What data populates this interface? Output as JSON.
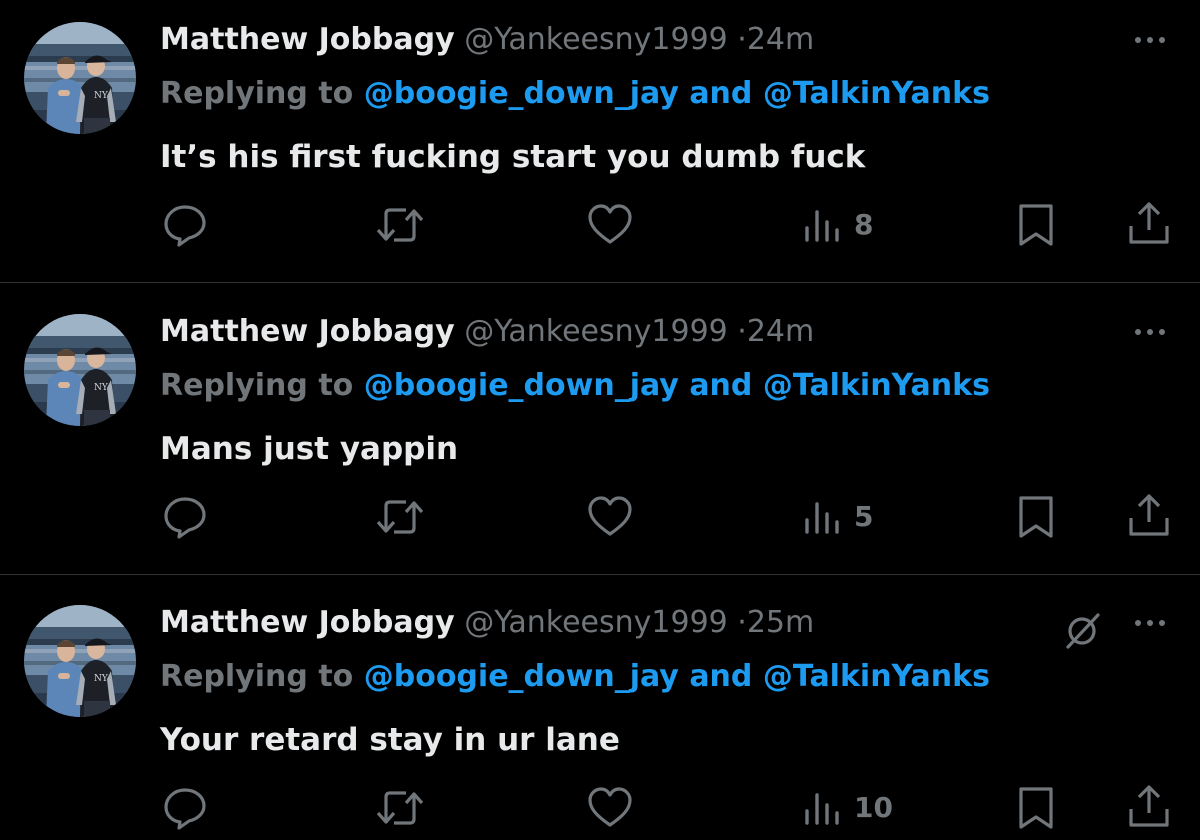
{
  "tweets": [
    {
      "display_name": "Matthew Jobbagy",
      "handle": "@Yankeesny1999",
      "separator": "·",
      "time": "24m",
      "replying_prefix": "Replying to",
      "mention_1": "@boogie_down_jay",
      "conjunction": "and",
      "mention_2": "@TalkinYanks",
      "text": "It’s his first fucking start you dumb fuck",
      "views": "8"
    },
    {
      "display_name": "Matthew Jobbagy",
      "handle": "@Yankeesny1999",
      "separator": "·",
      "time": "24m",
      "replying_prefix": "Replying to",
      "mention_1": "@boogie_down_jay",
      "conjunction": "and",
      "mention_2": "@TalkinYanks",
      "text": "Mans just yappin",
      "views": "5"
    },
    {
      "display_name": "Matthew Jobbagy",
      "handle": "@Yankeesny1999",
      "separator": "·",
      "time": "25m",
      "replying_prefix": "Replying to",
      "mention_1": "@boogie_down_jay",
      "conjunction": "and",
      "mention_2": "@TalkinYanks",
      "text": "Your retard stay in ur lane",
      "views": "10"
    }
  ],
  "icons": {
    "more": "more-horizontal-icon",
    "grok": "grok-icon",
    "reply": "reply-icon",
    "retweet": "retweet-icon",
    "like": "like-icon",
    "views": "views-icon",
    "bookmark": "bookmark-icon",
    "share": "share-icon"
  },
  "colors": {
    "background": "#000000",
    "primary_text": "#e7e9ea",
    "secondary_text": "#71767b",
    "mention": "#1d9bf0",
    "divider": "#2f3336"
  }
}
